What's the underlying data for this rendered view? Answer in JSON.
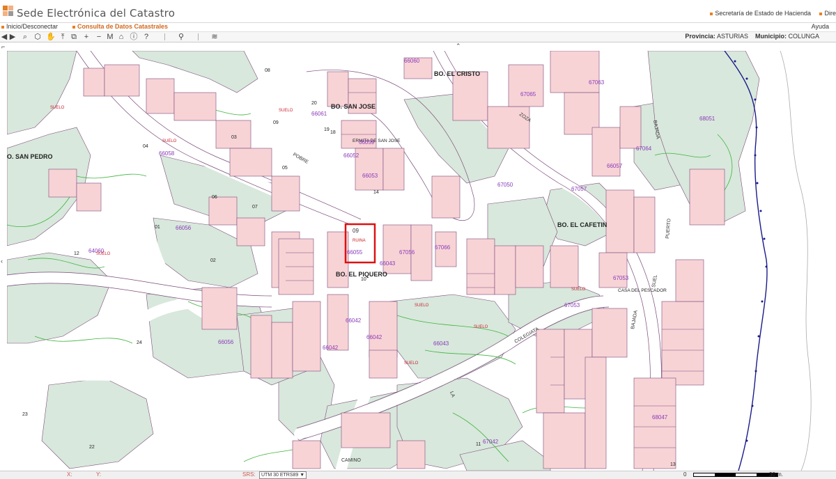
{
  "header": {
    "title": "Sede Electrónica del Catastro",
    "links": [
      "Secretaría de Estado de Hacienda",
      "Dire"
    ]
  },
  "menu": {
    "login": "Inicio/Desconectar",
    "consulta": "Consulta de Datos Catastrales",
    "help": "Ayuda"
  },
  "toolbar": {
    "tools": [
      "back-arrow",
      "forward-arrow",
      "zoom-icon",
      "select-icon",
      "pan-hand",
      "zoom-in-icon",
      "zoom-window-icon",
      "plus",
      "minus",
      "M",
      "home-icon",
      "info-icon",
      "help-icon",
      "pin-icon",
      "layers-icon"
    ],
    "provincia_label": "Provincia:",
    "provincia": "ASTURIAS",
    "municipio_label": "Municipio:",
    "municipio": "COLUNGA"
  },
  "status": {
    "x_label": "X:",
    "y_label": "Y:",
    "srs_label": "SRS:",
    "srs_value": "UTM 30 ETRS89 ▼",
    "scale_start": "0",
    "scale_end": "30 m."
  },
  "map": {
    "selected_parcel": "09",
    "selected_parcel_note": "RUINA",
    "sheets": [
      "66060",
      "66061",
      "67065",
      "67063",
      "68051",
      "66058",
      "66059",
      "66057",
      "66052",
      "67064",
      "67057",
      "66056",
      "64060",
      "66055",
      "67056",
      "67066",
      "66053",
      "67053",
      "67053",
      "67050",
      "66043",
      "66042",
      "66042",
      "66042",
      "66043",
      "66056",
      "68047",
      "67042"
    ],
    "places": [
      "BO. EL CRISTO",
      "BO. SAN JOSE",
      "O. SAN PEDRO",
      "BO. EL CAFETIN",
      "BO. EL PIQUERO",
      "CASA DEL PESCADOR",
      "ERMITA DE SAN JOSE",
      "POBRE",
      "ZOZA",
      "BAJADA",
      "PUERTO",
      "COLEGIATA",
      "LA",
      "CAMINO",
      "BAJADA",
      "SUEL"
    ],
    "parcels": [
      "08",
      "09",
      "05",
      "04",
      "03",
      "02",
      "01",
      "06",
      "07",
      "10",
      "11",
      "12",
      "13",
      "14",
      "20",
      "22",
      "23",
      "24",
      "19",
      "18"
    ],
    "labels": [
      "SUELO",
      "RUINA"
    ]
  }
}
